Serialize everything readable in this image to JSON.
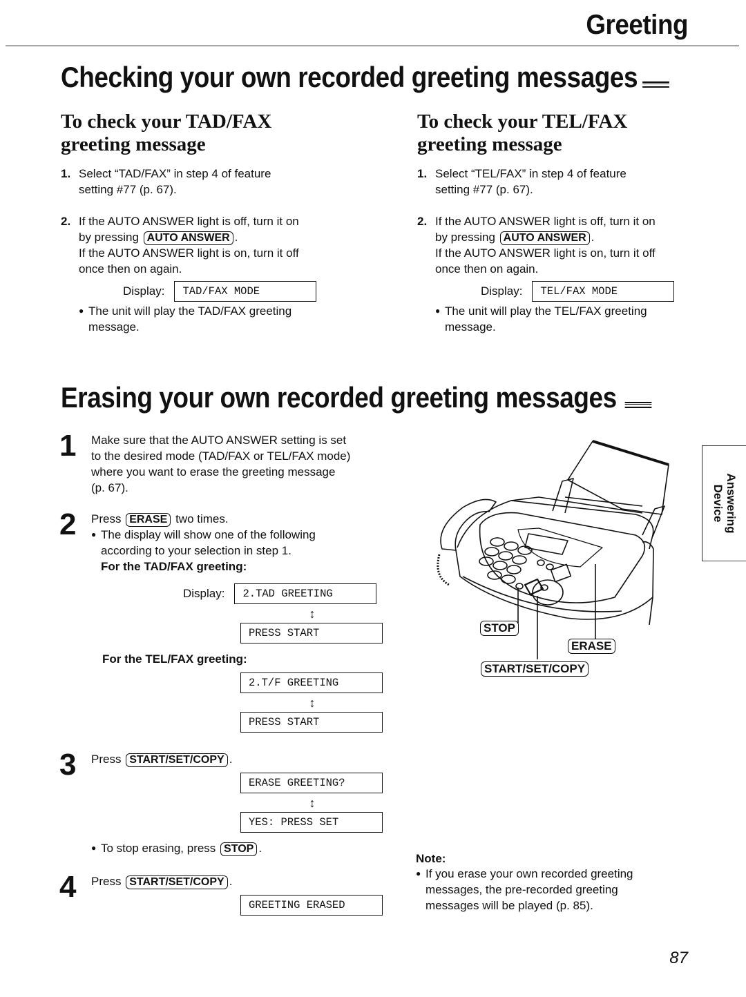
{
  "header": {
    "section_title": "Greeting"
  },
  "check_section": {
    "title": "Checking your own recorded greeting messages",
    "tad": {
      "heading_line1": "To check your TAD/FAX",
      "heading_line2": "greeting message",
      "step1_num": "1.",
      "step1_line1": "Select “TAD/FAX” in step 4 of feature",
      "step1_line2": "setting #77 (p. 67).",
      "step2_num": "2.",
      "step2_line1": "If the AUTO ANSWER light is off, turn it on",
      "step2_line2_pre": "by pressing",
      "step2_key": "AUTO ANSWER",
      "step2_line2_post": ".",
      "step2_line3": "If the AUTO ANSWER light is on, turn it off",
      "step2_line4": "once then on again.",
      "display_label": "Display:",
      "display_value": "TAD/FAX MODE",
      "bullet_line1": "The unit will play the TAD/FAX greeting",
      "bullet_line2": "message."
    },
    "tel": {
      "heading_line1": "To check your TEL/FAX",
      "heading_line2": "greeting message",
      "step1_num": "1.",
      "step1_line1": "Select “TEL/FAX” in step 4 of feature",
      "step1_line2": "setting #77 (p. 67).",
      "step2_num": "2.",
      "step2_line1": "If the AUTO ANSWER light is off, turn it on",
      "step2_line2_pre": "by pressing",
      "step2_key": "AUTO ANSWER",
      "step2_line2_post": ".",
      "step2_line3": "If the AUTO ANSWER light is on, turn it off",
      "step2_line4": "once then on again.",
      "display_label": "Display:",
      "display_value": "TEL/FAX MODE",
      "bullet_line1": "The unit will play the TEL/FAX greeting",
      "bullet_line2": "message."
    }
  },
  "erase_section": {
    "title": "Erasing your own recorded greeting messages",
    "step1": {
      "num": "1",
      "line1": "Make sure that the AUTO ANSWER setting is set",
      "line2": "to the desired mode (TAD/FAX or TEL/FAX mode)",
      "line3": "where you want to erase the greeting message",
      "line4": "(p. 67)."
    },
    "step2": {
      "num": "2",
      "press": "Press",
      "key": "ERASE",
      "after": "two times.",
      "bullet_line1": "The display will show one of the following",
      "bullet_line2": "according to your selection in step 1.",
      "tad_heading": "For the TAD/FAX greeting:",
      "display_label": "Display:",
      "tad_display1": "2.TAD GREETING",
      "tad_display2": "PRESS START",
      "tel_heading": "For the TEL/FAX greeting:",
      "tel_display1": "2.T/F GREETING",
      "tel_display2": "PRESS START",
      "arrow": "↕"
    },
    "step3": {
      "num": "3",
      "press": "Press",
      "key": "START/SET/COPY",
      "after": ".",
      "display1": "ERASE GREETING?",
      "display2": "YES: PRESS SET",
      "arrow": "↕",
      "bullet_pre": "To stop erasing, press",
      "bullet_key": "STOP",
      "bullet_post": "."
    },
    "step4": {
      "num": "4",
      "press": "Press",
      "key": "START/SET/COPY",
      "after": ".",
      "display1": "GREETING ERASED"
    }
  },
  "illustration": {
    "label_stop": "STOP",
    "label_erase": "ERASE",
    "label_start": "START/SET/COPY"
  },
  "note": {
    "heading": "Note:",
    "line1": "If you erase your own recorded greeting",
    "line2": "messages, the pre-recorded greeting",
    "line3": "messages will be played (p. 85)."
  },
  "side_tab": {
    "line1": "Answering",
    "line2": "Device"
  },
  "page_number": "87"
}
